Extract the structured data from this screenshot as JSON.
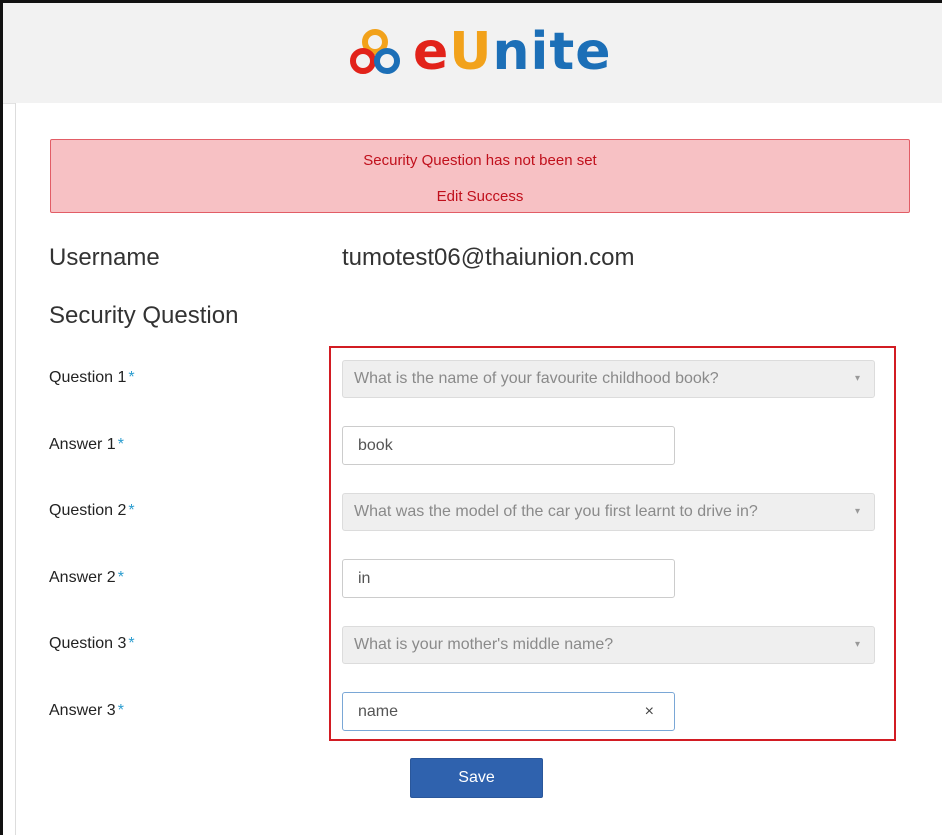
{
  "brand": {
    "logo_text_e": "e",
    "logo_text_u": "U",
    "logo_text_rest": "nite",
    "colors": {
      "red": "#e2231a",
      "orange": "#f2a21b",
      "blue": "#1c6fb7"
    }
  },
  "alert": {
    "line1": "Security Question has not been set",
    "line2": "Edit Success",
    "background": "#f7c1c4",
    "text_color": "#c0101c"
  },
  "profile": {
    "username_label": "Username",
    "username_value": "tumotest06@thaiunion.com",
    "section_title": "Security Question"
  },
  "form": {
    "required_mark": "*",
    "q1": {
      "label": "Question 1",
      "value": "What is the name of your favourite childhood book?"
    },
    "a1": {
      "label": "Answer 1",
      "value": "book"
    },
    "q2": {
      "label": "Question 2",
      "value": "What was the model of the car you first learnt to drive in?"
    },
    "a2": {
      "label": "Answer 2",
      "value": "in"
    },
    "q3": {
      "label": "Question 3",
      "value": "What is your mother's middle name?"
    },
    "a3": {
      "label": "Answer 3",
      "value": "name"
    },
    "caret_icon": "▾",
    "clear_icon": "×",
    "save_label": "Save",
    "save_color": "#2f62ae"
  }
}
